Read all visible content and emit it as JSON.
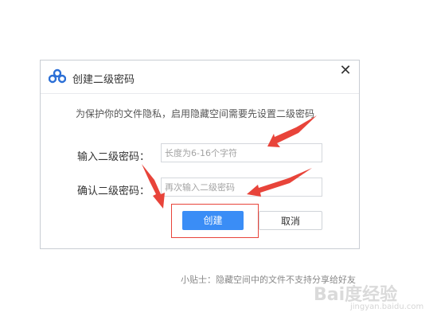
{
  "dialog": {
    "title": "创建二级密码",
    "close_glyph": "✕",
    "description": "为保护你的文件隐私，启用隐藏空间需要先设置二级密码",
    "password_label": "输入二级密码：",
    "password_placeholder": "长度为6-16个字符",
    "confirm_label": "确认二级密码：",
    "confirm_placeholder": "再次输入二级密码",
    "create_label": "创建",
    "cancel_label": "取消"
  },
  "tip": "小贴士：隐藏空间中的文件不支持分享给好友",
  "watermark": "Bai度经验",
  "watermark_url": "jingyan.baidu.com",
  "colors": {
    "primary": "#3a8df6",
    "annotation_red": "#e8443a",
    "logo_blue": "#2b6fd6"
  },
  "icons": {
    "logo": "cloud-logo-icon",
    "close": "close-icon"
  }
}
